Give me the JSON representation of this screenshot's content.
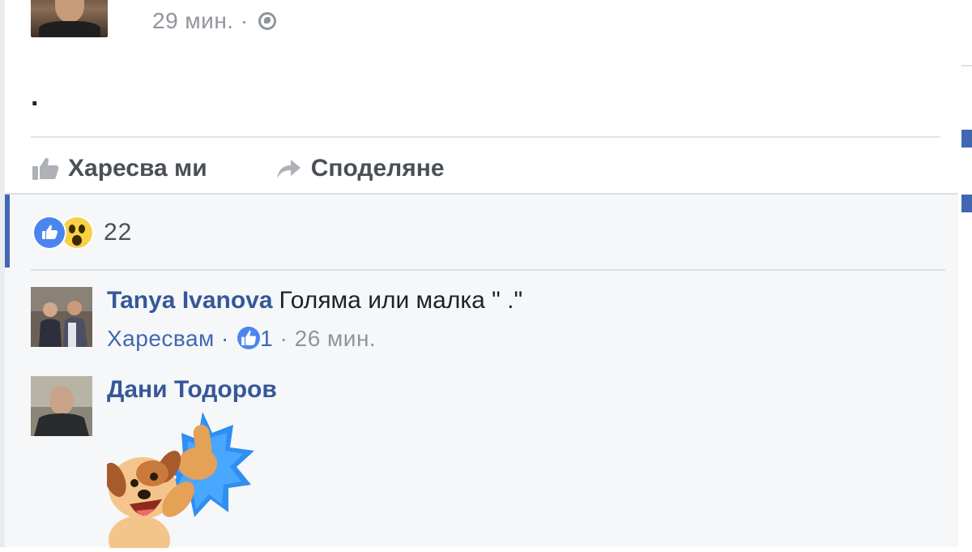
{
  "post": {
    "timestamp": "29 мин. ·",
    "body": ".",
    "actions": {
      "like_label": "Харесва ми",
      "share_label": "Споделяне"
    },
    "reactions": {
      "types": [
        "like",
        "wow"
      ],
      "count": "22"
    }
  },
  "comments": [
    {
      "author": "Tanya Ivanova",
      "text": "Голяма или малка \" .\"",
      "like_action": "Харесвам ·",
      "likes": "1",
      "time": "· 26 мин."
    },
    {
      "author": "Дани Тодоров",
      "text": "",
      "attachment": "sticker-puppy-thumbs-up"
    }
  ],
  "colors": {
    "link": "#365899",
    "accent": "#4267b2",
    "muted": "#90949c",
    "comment_bg": "#f6f7f9"
  }
}
